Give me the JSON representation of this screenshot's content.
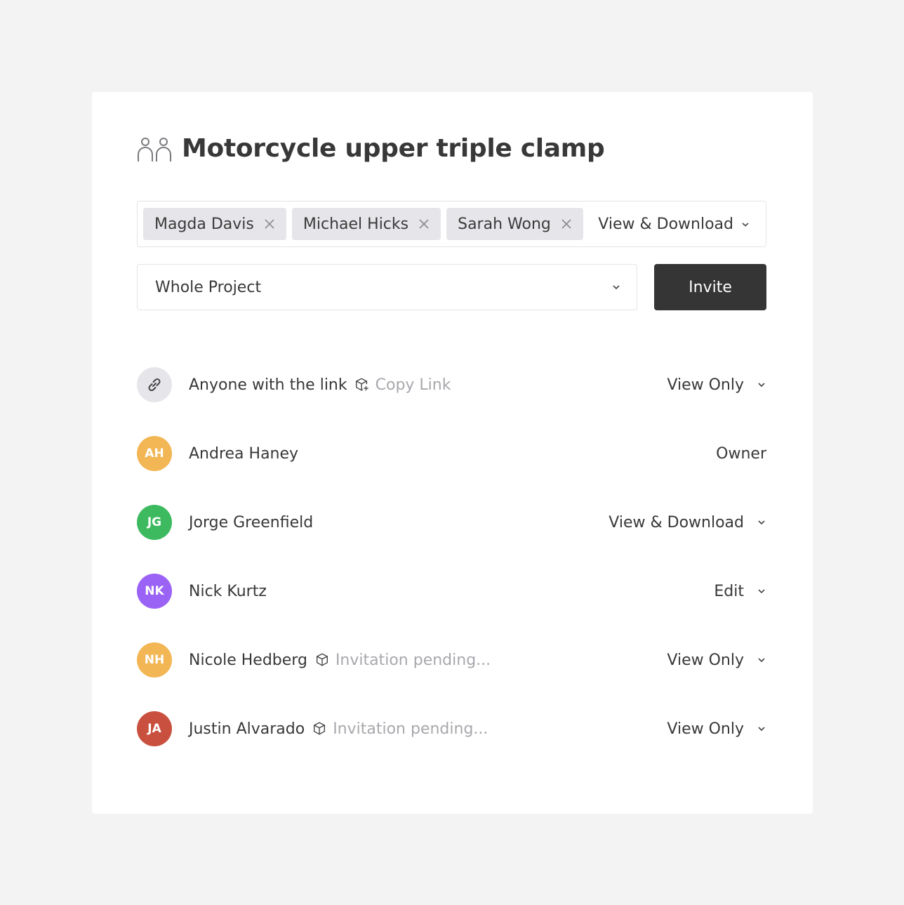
{
  "dialog": {
    "title": "Motorcycle upper triple clamp",
    "title_icon": "people-icon"
  },
  "invite": {
    "chips": [
      {
        "name": "Magda Davis",
        "remove_icon": "close-icon"
      },
      {
        "name": "Michael Hicks",
        "remove_icon": "close-icon"
      },
      {
        "name": "Sarah Wong",
        "remove_icon": "close-icon"
      }
    ],
    "permission": "View & Download",
    "scope": "Whole Project",
    "invite_label": "Invite"
  },
  "link_row": {
    "label": "Anyone with the link",
    "action": "Copy Link",
    "role": "View Only",
    "icon": "link-icon"
  },
  "members": [
    {
      "initials": "AH",
      "name": "Andrea Haney",
      "role": "Owner",
      "color": "#f2b654",
      "pending": null,
      "dropdown": false
    },
    {
      "initials": "JG",
      "name": "Jorge Greenfield",
      "role": "View & Download",
      "color": "#3dba60",
      "pending": null,
      "dropdown": true
    },
    {
      "initials": "NK",
      "name": "Nick Kurtz",
      "role": "Edit",
      "color": "#9a62f5",
      "pending": null,
      "dropdown": true
    },
    {
      "initials": "NH",
      "name": "Nicole Hedberg",
      "role": "View Only",
      "color": "#f2b654",
      "pending": "Invitation pending...",
      "dropdown": true
    },
    {
      "initials": "JA",
      "name": "Justin Alvarado",
      "role": "View Only",
      "color": "#c9503e",
      "pending": "Invitation pending...",
      "dropdown": true
    }
  ],
  "colors": {
    "background": "#f3f3f3",
    "card": "#ffffff",
    "chip": "#e6e6ea",
    "invite_button": "#353535",
    "muted_text": "#a8a8ad"
  }
}
